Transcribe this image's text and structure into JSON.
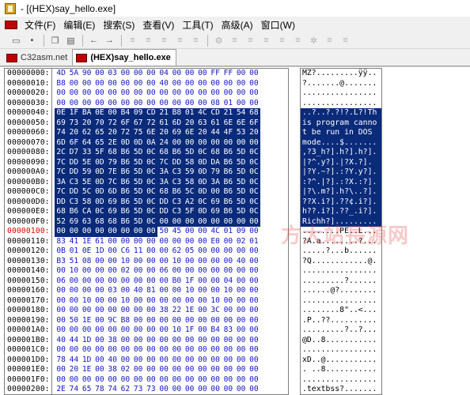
{
  "window": {
    "title": "- [(HEX)say_hello.exe]"
  },
  "menu": [
    "文件(F)",
    "编辑(E)",
    "搜索(S)",
    "查看(V)",
    "工具(T)",
    "高级(A)",
    "窗口(W)"
  ],
  "toolbar": [
    {
      "icon": "open-folder-icon",
      "glyph": "▭"
    },
    {
      "icon": "save-icon",
      "glyph": "▪"
    },
    {
      "sep": true
    },
    {
      "icon": "copy-icon",
      "glyph": "❐"
    },
    {
      "icon": "paste-icon",
      "glyph": "▤"
    },
    {
      "sep": true
    },
    {
      "icon": "arrow-left-icon",
      "glyph": "←"
    },
    {
      "icon": "arrow-right-icon",
      "glyph": "→"
    },
    {
      "sep": true
    },
    {
      "icon": "tool-1-icon",
      "glyph": "≡",
      "disabled": true
    },
    {
      "icon": "tool-2-icon",
      "glyph": "≡",
      "disabled": true
    },
    {
      "icon": "tool-3-icon",
      "glyph": "≡",
      "disabled": true
    },
    {
      "icon": "tool-4-icon",
      "glyph": "≡",
      "disabled": true
    },
    {
      "icon": "tool-5-icon",
      "glyph": "≡",
      "disabled": true
    },
    {
      "sep": true
    },
    {
      "icon": "tool-6-icon",
      "glyph": "⚙",
      "disabled": true
    },
    {
      "icon": "tool-7-icon",
      "glyph": "≡",
      "disabled": true
    },
    {
      "icon": "tool-8-icon",
      "glyph": "≡",
      "disabled": true
    },
    {
      "icon": "tool-9-icon",
      "glyph": "≡",
      "disabled": true
    },
    {
      "icon": "tool-10-icon",
      "glyph": "≡",
      "disabled": true
    },
    {
      "icon": "tool-11-icon",
      "glyph": "≡",
      "disabled": true
    },
    {
      "icon": "tool-12-icon",
      "glyph": "✲",
      "disabled": true
    },
    {
      "icon": "tool-13-icon",
      "glyph": "≡",
      "disabled": true
    },
    {
      "icon": "tool-14-icon",
      "glyph": "≡",
      "disabled": true
    }
  ],
  "tabs": [
    {
      "label": "C32asm.net",
      "active": false
    },
    {
      "label": "(HEX)say_hello.exe",
      "active": true
    }
  ],
  "watermark": "方大站長源网",
  "rows": [
    {
      "off": "00000000:",
      "hex": "4D 5A 90 00 03 00 00 00 04 00 00 00 FF FF 00 00",
      "asc": "MZ?.........ÿÿ..",
      "sel": [],
      "asc_sel": false
    },
    {
      "off": "00000010:",
      "hex": "B8 00 00 00 00 00 00 00 40 00 00 00 00 00 00 00",
      "asc": "?.......@.......",
      "sel": [],
      "asc_sel": false
    },
    {
      "off": "00000020:",
      "hex": "00 00 00 00 00 00 00 00 00 00 00 00 00 00 00 00",
      "asc": "................",
      "sel": [],
      "asc_sel": false
    },
    {
      "off": "00000030:",
      "hex": "00 00 00 00 00 00 00 00 00 00 00 00 08 01 00 00",
      "asc": "................",
      "sel": [],
      "asc_sel": false
    },
    {
      "off": "00000040:",
      "hex": "0E 1F BA 0E 00 B4 09 CD 21 B8 01 4C CD 21 54 68",
      "asc": "..?..?.?!?.L?!Th",
      "sel": "all",
      "asc_sel": true
    },
    {
      "off": "00000050:",
      "hex": "69 73 20 70 72 6F 67 72 61 6D 20 63 61 6E 6E 6F",
      "asc": "is program canno",
      "sel": "all",
      "asc_sel": true
    },
    {
      "off": "00000060:",
      "hex": "74 20 62 65 20 72 75 6E 20 69 6E 20 44 4F 53 20",
      "asc": "t be run in DOS ",
      "sel": "all",
      "asc_sel": true
    },
    {
      "off": "00000070:",
      "hex": "6D 6F 64 65 2E 0D 0D 0A 24 00 00 00 00 00 00 00",
      "asc": "mode....$.......",
      "sel": "all",
      "asc_sel": true
    },
    {
      "off": "00000080:",
      "hex": "2C D7 33 5F 68 B6 5D 0C 68 B6 5D 0C 68 B6 5D 0C",
      "asc": ",?3_h?].h?].h?].",
      "sel": "all",
      "asc_sel": true
    },
    {
      "off": "00000090:",
      "hex": "7C DD 5E 0D 79 B6 5D 0C 7C DD 58 0D DA B6 5D 0C",
      "asc": "|?^.y?].|?X.?].",
      "sel": "all",
      "asc_sel": true
    },
    {
      "off": "000000A0:",
      "hex": "7C DD 59 0D 7E B6 5D 0C 3A C3 59 0D 79 B6 5D 0C",
      "asc": "|?Y.~?].:?Y.y?].",
      "sel": "all",
      "asc_sel": true
    },
    {
      "off": "000000B0:",
      "hex": "3A C3 5E 0D 7C B6 5D 0C 3A C3 58 0D 3A B6 5D 0C",
      "asc": ":?^.|?].:?X.:?].",
      "sel": "all",
      "asc_sel": true
    },
    {
      "off": "000000C0:",
      "hex": "7C DD 5C 0D 6D B6 5D 0C 68 B6 5C 0D 00 B6 5D 0C",
      "asc": "|?\\.m?].h?\\..?].",
      "sel": "all",
      "asc_sel": true
    },
    {
      "off": "000000D0:",
      "hex": "DD C3 58 0D 69 B6 5D 0C DD C3 A2 0C 69 B6 5D 0C",
      "asc": "??X.i?].??¢.i?].",
      "sel": "all",
      "asc_sel": true
    },
    {
      "off": "000000E0:",
      "hex": "68 B6 CA 0C 69 B6 5D 0C DD C3 5F 0D 69 B6 5D 0C",
      "asc": "h??.i?].??_.i?].",
      "sel": "all",
      "asc_sel": true
    },
    {
      "off": "000000F0:",
      "hex": "52 69 63 68 68 B6 5D 0C 00 00 00 00 00 00 00 00",
      "asc": "Richh?].........",
      "sel": "all",
      "asc_sel": true
    },
    {
      "off": "00000100:",
      "hex": "00 00 00 00 00 00 00 00 50 45 00 00 4C 01 09 00",
      "asc": "........PE..L...",
      "sel": [
        0,
        1,
        2,
        3,
        4,
        5,
        6,
        7
      ],
      "asc_sel": false,
      "current": true
    },
    {
      "off": "00000110:",
      "hex": "83 41 1E 61 00 00 00 00 00 00 00 00 E0 00 02 01",
      "asc": "?A.a........?...",
      "sel": [],
      "asc_sel": false
    },
    {
      "off": "00000120:",
      "hex": "0B 01 0E 1D 00 C6 11 00 00 62 05 00 00 00 00 00",
      "asc": ".....?...b......",
      "sel": [],
      "asc_sel": false
    },
    {
      "off": "00000130:",
      "hex": "B3 51 08 00 00 10 00 00 00 10 00 00 00 00 40 00",
      "asc": "?Q............@.",
      "sel": [],
      "asc_sel": false
    },
    {
      "off": "00000140:",
      "hex": "00 10 00 00 00 02 00 00 06 00 00 00 00 00 00 00",
      "asc": "................",
      "sel": [],
      "asc_sel": false
    },
    {
      "off": "00000150:",
      "hex": "06 00 00 00 00 00 00 00 00 B0 1F 00 00 04 00 00",
      "asc": ".........?......",
      "sel": [],
      "asc_sel": false
    },
    {
      "off": "00000160:",
      "hex": "00 00 00 00 03 00 40 81 00 00 10 00 00 10 00 00",
      "asc": "......@?........",
      "sel": [],
      "asc_sel": false
    },
    {
      "off": "00000170:",
      "hex": "00 00 10 00 00 10 00 00 00 00 00 00 10 00 00 00",
      "asc": "................",
      "sel": [],
      "asc_sel": false
    },
    {
      "off": "00000180:",
      "hex": "00 00 00 00 00 00 00 00 38 22 1E 00 3C 00 00 00",
      "asc": "........8\"..<...",
      "sel": [],
      "asc_sel": false
    },
    {
      "off": "00000190:",
      "hex": "00 50 1E 00 9C B8 00 00 00 00 00 00 00 00 00 00",
      "asc": ".P..??..........",
      "sel": [],
      "asc_sel": false
    },
    {
      "off": "000001A0:",
      "hex": "00 00 00 00 00 00 00 00 00 10 1F 00 B4 83 00 00",
      "asc": ".........?..?...",
      "sel": [],
      "asc_sel": false
    },
    {
      "off": "000001B0:",
      "hex": "40 44 1D 00 38 00 00 00 00 00 00 00 00 00 00 00",
      "asc": "@D..8...........",
      "sel": [],
      "asc_sel": false
    },
    {
      "off": "000001C0:",
      "hex": "00 00 00 00 00 00 00 00 00 00 00 00 00 00 00 00",
      "asc": "................",
      "sel": [],
      "asc_sel": false
    },
    {
      "off": "000001D0:",
      "hex": "78 44 1D 00 40 00 00 00 00 00 00 00 00 00 00 00",
      "asc": "xD..@...........",
      "sel": [],
      "asc_sel": false
    },
    {
      "off": "000001E0:",
      "hex": "00 20 1E 00 38 02 00 00 00 00 00 00 00 00 00 00",
      "asc": ". ..8...........",
      "sel": [],
      "asc_sel": false
    },
    {
      "off": "000001F0:",
      "hex": "00 00 00 00 00 00 00 00 00 00 00 00 00 00 00 00",
      "asc": "................",
      "sel": [],
      "asc_sel": false
    },
    {
      "off": "00000200:",
      "hex": "2E 74 65 78 74 62 73 73 00 00 00 00 00 00 00 00",
      "asc": ".textbss?.......",
      "sel": [],
      "asc_sel": false
    }
  ]
}
